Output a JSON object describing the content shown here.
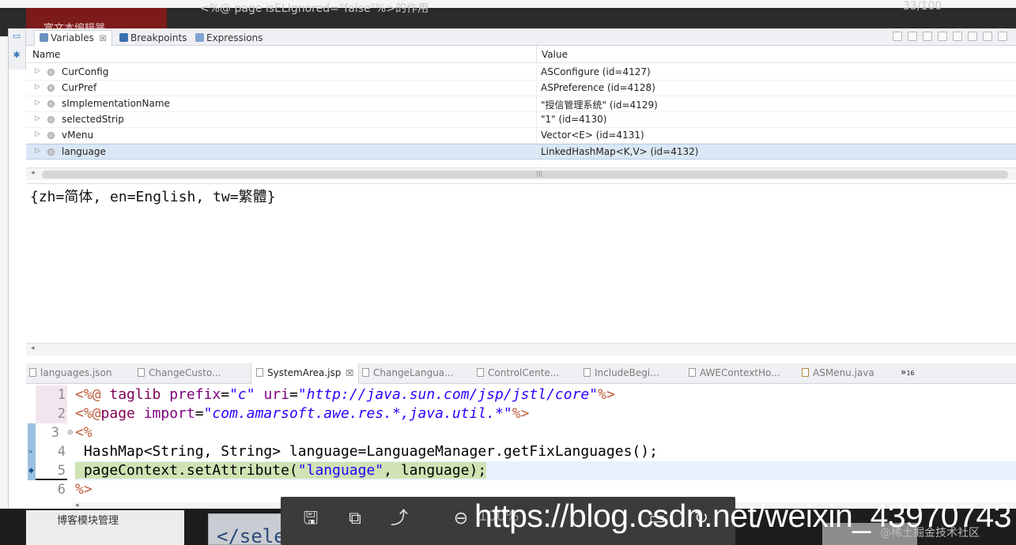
{
  "background": {
    "article_title": "<%@ page isELIgnored=\"false\"%>的作用",
    "page_counter": "33/100",
    "rich_text_editor": "富文本编辑器",
    "blog_module": "博客模块管理",
    "code_thumb": "</select>"
  },
  "view_tabs": [
    {
      "label": "Variables",
      "close": "☒",
      "icon": "variables-icon"
    },
    {
      "label": "Breakpoints",
      "icon": "breakpoint-icon"
    },
    {
      "label": "Expressions",
      "icon": "expressions-icon"
    }
  ],
  "variables": {
    "columns": {
      "name": "Name",
      "value": "Value"
    },
    "rows": [
      {
        "name": "CurConfig",
        "value": "ASConfigure  (id=4127)"
      },
      {
        "name": "CurPref",
        "value": "ASPreference  (id=4128)"
      },
      {
        "name": "sImplementationName",
        "value": "\"授信管理系统\" (id=4129)"
      },
      {
        "name": "selectedStrip",
        "value": "\"1\" (id=4130)"
      },
      {
        "name": "vMenu",
        "value": "Vector<E>  (id=4131)"
      },
      {
        "name": "language",
        "value": "LinkedHashMap<K,V>  (id=4132)",
        "selected": true
      }
    ]
  },
  "detail": "{zh=简体, en=English, tw=繁體}",
  "editor_tabs": [
    {
      "label": "languages.json"
    },
    {
      "label": "ChangeCusto..."
    },
    {
      "label": "SystemArea.jsp",
      "active": true,
      "close": "☒"
    },
    {
      "label": "ChangeLangua..."
    },
    {
      "label": "ControlCente..."
    },
    {
      "label": "IncludeBegi..."
    },
    {
      "label": "AWEContextHo..."
    },
    {
      "label": "ASMenu.java"
    }
  ],
  "editor_tabs_more": {
    "symbol": "»",
    "count": "16"
  },
  "code": {
    "line_numbers": [
      "1",
      "2",
      "3",
      "4",
      "5",
      "6"
    ],
    "l1": {
      "open": "<%@",
      "directive": " taglib ",
      "a1": "prefix",
      "eq1": "=",
      "v1": "\"c\"",
      "a2": " uri",
      "eq2": "=",
      "v2": "\"http://java.sun.com/jsp/jstl/core\"",
      "close": "%>"
    },
    "l2": {
      "open": "<%@",
      "directive": "page ",
      "a1": "import",
      "eq1": "=",
      "v1": "\"com.amarsoft.awe.res.*,java.util.*\"",
      "close": "%>"
    },
    "l3": "<%",
    "l4": " HashMap<String, String> language=LanguageManager.getFixLanguages();",
    "l5": {
      "pre": " pageContext.setAttribute(",
      "str": "\"language\"",
      "post": ", language);"
    },
    "l6": "%>"
  },
  "viewer": {
    "zoom": "100%"
  },
  "watermarks": {
    "url": "https://blog.csdn.net/weixin_43970743",
    "juejin": "@稀土掘金技术社区"
  }
}
